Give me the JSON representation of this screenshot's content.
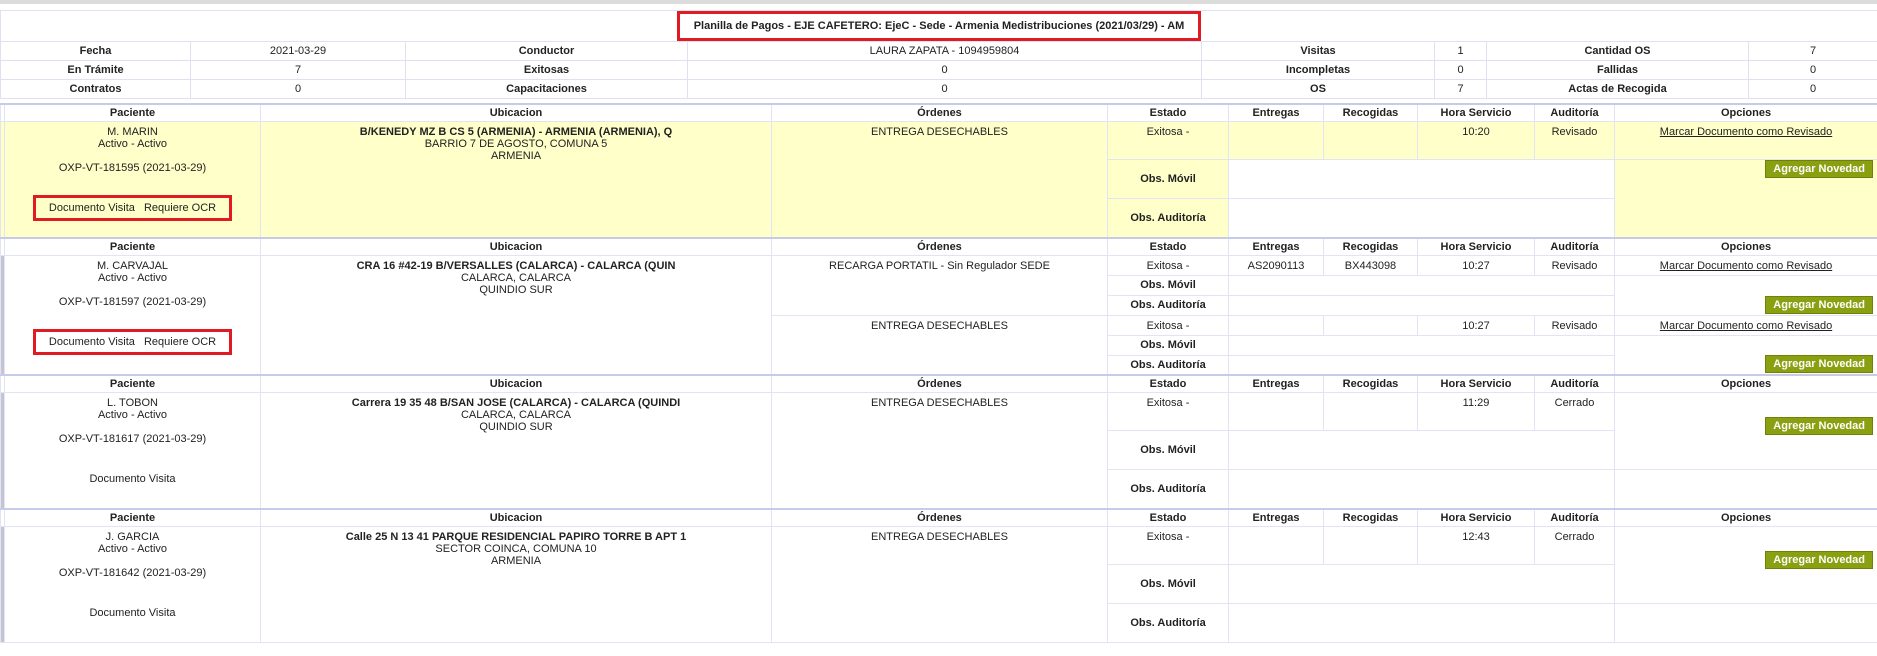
{
  "header": {
    "title": "Planilla de Pagos - EJE CAFETERO: EjeC - Sede - Armenia Medistribuciones (2021/03/29) - AM",
    "row1": {
      "fecha_label": "Fecha",
      "fecha": "2021-03-29",
      "conductor_label": "Conductor",
      "conductor": "LAURA ZAPATA - 1094959804",
      "visitas_label": "Visitas",
      "visitas": "1",
      "cantidad_os_label": "Cantidad OS",
      "cantidad_os": "7"
    },
    "row2": {
      "en_tramite_label": "En Trámite",
      "en_tramite": "7",
      "exitosas_label": "Exitosas",
      "exitosas": "0",
      "incompletas_label": "Incompletas",
      "incompletas": "0",
      "fallidas_label": "Fallidas",
      "fallidas": "0"
    },
    "row3": {
      "contratos_label": "Contratos",
      "contratos": "0",
      "capacitaciones_label": "Capacitaciones",
      "capacitaciones": "0",
      "os_label": "OS",
      "os": "7",
      "actas_label": "Actas de Recogida",
      "actas": "0"
    }
  },
  "columns": {
    "paciente": "Paciente",
    "ubicacion": "Ubicacion",
    "ordenes": "Órdenes",
    "estado": "Estado",
    "entregas": "Entregas",
    "recogidas": "Recogidas",
    "hora": "Hora Servicio",
    "auditoria": "Auditoría",
    "opciones": "Opciones"
  },
  "labels": {
    "obs_movil": "Obs. Móvil",
    "obs_auditoria": "Obs. Auditoría",
    "marcar": "Marcar Documento como Revisado",
    "agregar": "Agregar Novedad",
    "doc_visita": "Documento Visita",
    "requiere_ocr": "Requiere OCR"
  },
  "patients": [
    {
      "name": "M. MARIN",
      "status": "Activo - Activo",
      "code": "OXP-VT-181595 (2021-03-29)",
      "loc1": "B/KENEDY MZ B CS 5 (ARMENIA) - ARMENIA (ARMENIA), Q",
      "loc2": "BARRIO 7 DE AGOSTO, COMUNA 5",
      "loc3": "ARMENIA",
      "orders": [
        {
          "name": "ENTREGA DESECHABLES",
          "estado": "Exitosa -",
          "entregas": "",
          "recogidas": "",
          "hora": "10:20",
          "auditoria": "Revisado"
        }
      ]
    },
    {
      "name": "M. CARVAJAL",
      "status": "Activo - Activo",
      "code": "OXP-VT-181597 (2021-03-29)",
      "loc1": "CRA 16 #42-19 B/VERSALLES (CALARCA) - CALARCA (QUIN",
      "loc2": "CALARCA, CALARCA",
      "loc3": "QUINDIO SUR",
      "orders": [
        {
          "name": "RECARGA PORTATIL - Sin Regulador SEDE",
          "estado": "Exitosa -",
          "entregas": "AS2090113",
          "recogidas": "BX443098",
          "hora": "10:27",
          "auditoria": "Revisado"
        },
        {
          "name": "ENTREGA DESECHABLES",
          "estado": "Exitosa -",
          "entregas": "",
          "recogidas": "",
          "hora": "10:27",
          "auditoria": "Revisado"
        }
      ]
    },
    {
      "name": "L. TOBON",
      "status": "Activo - Activo",
      "code": "OXP-VT-181617 (2021-03-29)",
      "loc1": "Carrera 19 35 48 B/SAN JOSE (CALARCA) - CALARCA (QUINDI",
      "loc2": "CALARCA, CALARCA",
      "loc3": "QUINDIO SUR",
      "orders": [
        {
          "name": "ENTREGA DESECHABLES",
          "estado": "Exitosa -",
          "entregas": "",
          "recogidas": "",
          "hora": "11:29",
          "auditoria": "Cerrado"
        }
      ]
    },
    {
      "name": "J. GARCIA",
      "status": "Activo - Activo",
      "code": "OXP-VT-181642 (2021-03-29)",
      "loc1": "Calle 25 N 13 41 PARQUE RESIDENCIAL PAPIRO TORRE B APT 1",
      "loc2": "SECTOR COINCA, COMUNA 10",
      "loc3": "ARMENIA",
      "orders": [
        {
          "name": "ENTREGA DESECHABLES",
          "estado": "Exitosa -",
          "entregas": "",
          "recogidas": "",
          "hora": "12:43",
          "auditoria": "Cerrado"
        }
      ]
    }
  ]
}
